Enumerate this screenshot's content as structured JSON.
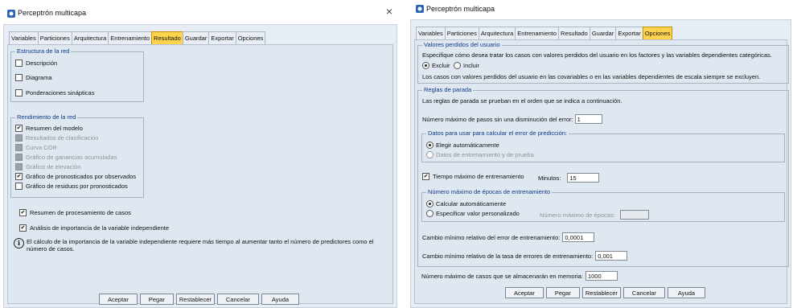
{
  "left": {
    "title": "Perceptrón multicapa",
    "close_glyph": "×",
    "tabs": [
      "Variables",
      "Particiones",
      "Arquitectura",
      "Entrenamiento",
      "Resultado",
      "Guardar",
      "Exportar",
      "Opciones"
    ],
    "active_tab": "Resultado",
    "estructura": {
      "legend": "Estructura de la red",
      "items": [
        {
          "label": "Descripción",
          "checked": false
        },
        {
          "label": "Diagrama",
          "checked": false
        },
        {
          "label": "Ponderaciones sinápticas",
          "checked": false
        }
      ]
    },
    "rendimiento": {
      "legend": "Rendimiento de la red",
      "items": [
        {
          "label": "Resumen del modelo",
          "checked": true,
          "enabled": true
        },
        {
          "label": "Resultados de clasificación",
          "checked": false,
          "enabled": false
        },
        {
          "label": "Curva COR",
          "checked": false,
          "enabled": false
        },
        {
          "label": "Gráfico de ganancias acumuladas",
          "checked": false,
          "enabled": false
        },
        {
          "label": "Gráfico de elevación",
          "checked": false,
          "enabled": false
        },
        {
          "label": "Gráfico de pronosticados por observados",
          "checked": true,
          "enabled": true
        },
        {
          "label": "Gráfico de residuos por pronosticados",
          "checked": false,
          "enabled": true
        }
      ]
    },
    "resumen_casos": {
      "label": "Resumen de procesamiento de casos",
      "checked": true
    },
    "analisis_importancia": {
      "label": "Análisis de importancia de la variable independiente",
      "checked": true
    },
    "info_glyph": "i",
    "info_text_1": "El cálculo de la importancia de la variable independiente requiere más tiempo al aumentar tanto el número de predictores como el",
    "info_text_2": "número de casos.",
    "buttons": [
      "Aceptar",
      "Pegar",
      "Restablecer",
      "Cancelar",
      "Ayuda"
    ]
  },
  "right": {
    "title": "Perceptrón multicapa",
    "tabs": [
      "Variables",
      "Particiones",
      "Arquitectura",
      "Entrenamiento",
      "Resultado",
      "Guardar",
      "Exportar",
      "Opciones"
    ],
    "active_tab": "Opciones",
    "valores_perdidos": {
      "legend": "Valores perdidos del usuario",
      "desc": "Especifique cómo desea tratar los casos con valores perdidos del usuario en los factores y las variables dependientes categóricas.",
      "opt_excluir": "Excluir",
      "opt_incluir": "Incluir",
      "note": "Los casos con valores perdidos del usuario en las covariables o en las variables dependientes de escala siempre se excluyen."
    },
    "reglas": {
      "legend": "Reglas de parada",
      "desc": "Las reglas de parada se prueban en el orden que se indica a continuación.",
      "max_pasos_label": "Número máximo de pasos sin una disminución del error:",
      "max_pasos_value": "1",
      "datos_legend": "Datos para usar para calcular el error de predicción:",
      "datos_opt1": "Elegir automáticamente",
      "datos_opt2": "Datos de entrenamiento y de prueba",
      "tiempo_label": "Tiempo máximo de entrenamiento",
      "tiempo_checked": true,
      "minutos_label": "Minutos:",
      "minutos_value": "15",
      "epocas_legend": "Número máximo de épocas de entrenamiento",
      "epocas_opt1": "Calcular automáticamente",
      "epocas_opt2": "Especificar valor personalizado",
      "epocas_field_label": "Número máximo de épocas:",
      "cambio_error_label": "Cambio mínimo relativo del error de entrenamiento:",
      "cambio_error_value": "0,0001",
      "cambio_tasa_label": "Cambio mínimo relativo de la tasa de errores de entrenamiento:",
      "cambio_tasa_value": "0,001"
    },
    "max_casos_label": "Número máximo de casos que se almacenarán en memoria:",
    "max_casos_value": "1000",
    "buttons": [
      "Aceptar",
      "Pegar",
      "Restablecer",
      "Cancelar",
      "Ayuda"
    ]
  }
}
